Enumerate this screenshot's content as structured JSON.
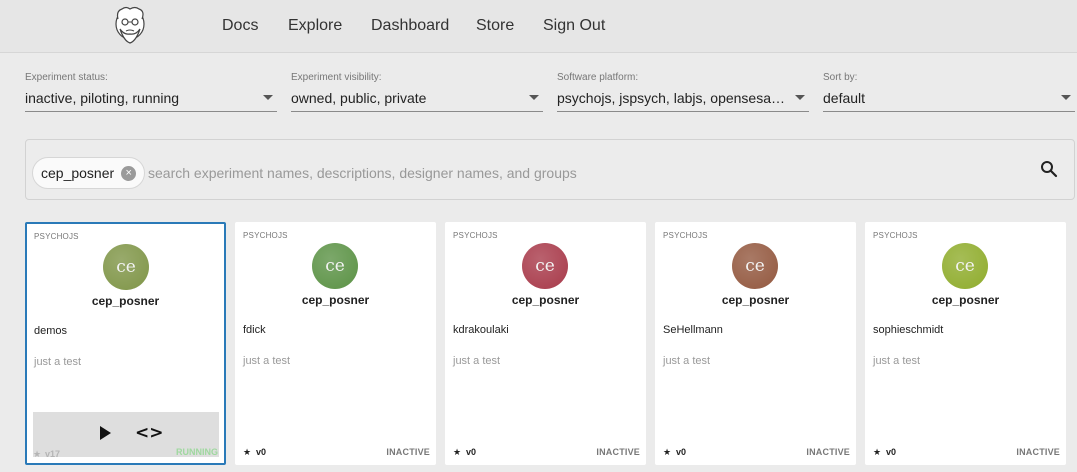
{
  "nav": {
    "links": [
      "Docs",
      "Explore",
      "Dashboard",
      "Store",
      "Sign Out"
    ]
  },
  "filters": {
    "status": {
      "label": "Experiment status:",
      "value": "inactive, piloting, running"
    },
    "visibility": {
      "label": "Experiment visibility:",
      "value": "owned, public, private"
    },
    "platform": {
      "label": "Software platform:",
      "value": "psychojs, jspsych, labjs, opensesame, ..."
    },
    "sort": {
      "label": "Sort by:",
      "value": "default"
    }
  },
  "search": {
    "chip": "cep_posner",
    "chip_remove": "×",
    "placeholder": "search experiment names, descriptions, designer names, and groups",
    "icon": "search-icon"
  },
  "cards": [
    {
      "platform": "PSYCHOJS",
      "avatar": "ce",
      "avatar_color": "#7f9547",
      "owner": "cep_posner",
      "name": "demos",
      "description": "just a test",
      "star": "★",
      "version": "v17",
      "status": "RUNNING"
    },
    {
      "platform": "PSYCHOJS",
      "avatar": "ce",
      "avatar_color": "#5b9245",
      "owner": "cep_posner",
      "name": "fdick",
      "description": "just a test",
      "star": "★",
      "version": "v0",
      "status": "INACTIVE"
    },
    {
      "platform": "PSYCHOJS",
      "avatar": "ce",
      "avatar_color": "#a83a4a",
      "owner": "cep_posner",
      "name": "kdrakoulaki",
      "description": "just a test",
      "star": "★",
      "version": "v0",
      "status": "INACTIVE"
    },
    {
      "platform": "PSYCHOJS",
      "avatar": "ce",
      "avatar_color": "#93583f",
      "owner": "cep_posner",
      "name": "SeHellmann",
      "description": "just a test",
      "star": "★",
      "version": "v0",
      "status": "INACTIVE"
    },
    {
      "platform": "PSYCHOJS",
      "avatar": "ce",
      "avatar_color": "#8fac2c",
      "owner": "cep_posner",
      "name": "sophieschmidt",
      "description": "just a test",
      "star": "★",
      "version": "v0",
      "status": "INACTIVE"
    }
  ],
  "hover_actions": {
    "run": "play-icon",
    "code": "<>"
  },
  "colors": {
    "selected_border": "#2a7ab8",
    "running": "#9fd89f"
  }
}
